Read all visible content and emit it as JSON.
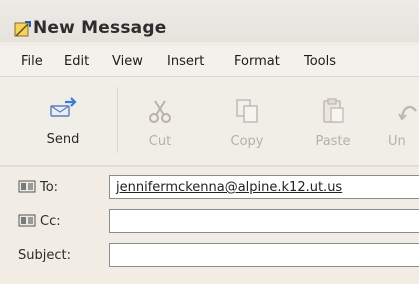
{
  "window": {
    "title": "New Message"
  },
  "menu": [
    "File",
    "Edit",
    "View",
    "Insert",
    "Format",
    "Tools"
  ],
  "toolbar": {
    "send": "Send",
    "cut": "Cut",
    "copy": "Copy",
    "paste": "Paste",
    "undo": "Un"
  },
  "fields": {
    "to": {
      "label": "To:",
      "value": "jennifermckenna@alpine.k12.ut.us"
    },
    "cc": {
      "label": "Cc:",
      "value": ""
    },
    "subject": {
      "label": "Subject:",
      "value": ""
    }
  },
  "icons": {
    "title": "compose-message-icon",
    "send": "send-icon",
    "cut": "scissors-icon",
    "copy": "copy-icon",
    "paste": "paste-icon",
    "undo": "undo-icon",
    "address_book": "address-book-icon"
  },
  "colors": {
    "accent": "#3a7bd5",
    "disabled": "#b6b1a8"
  }
}
